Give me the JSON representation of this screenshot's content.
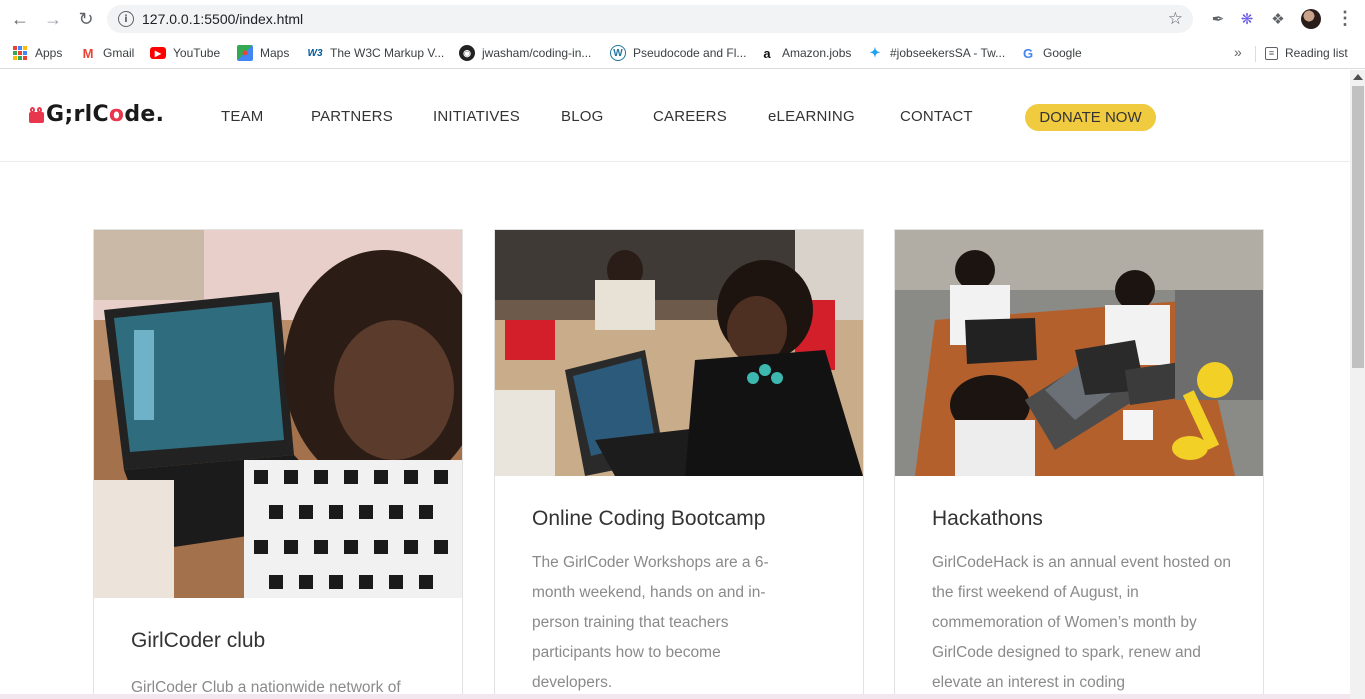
{
  "browser": {
    "url": "127.0.0.1:5500/index.html",
    "bookmarks": [
      {
        "label": "Apps",
        "icon": "apps-grid-icon"
      },
      {
        "label": "Gmail",
        "icon": "gmail-icon"
      },
      {
        "label": "YouTube",
        "icon": "youtube-icon"
      },
      {
        "label": "Maps",
        "icon": "maps-icon"
      },
      {
        "label": "The W3C Markup V...",
        "icon": "w3c-icon"
      },
      {
        "label": "jwasham/coding-in...",
        "icon": "github-icon"
      },
      {
        "label": "Pseudocode and Fl...",
        "icon": "wordpress-icon"
      },
      {
        "label": "Amazon.jobs",
        "icon": "amazon-icon"
      },
      {
        "label": "#jobseekersSA - Tw...",
        "icon": "twitter-icon"
      },
      {
        "label": "Google",
        "icon": "google-icon"
      }
    ],
    "bookmarks_more": "»",
    "reading_list": "Reading list"
  },
  "site": {
    "logo": {
      "part1": "G",
      "part2": ";rlC",
      "part3": "o",
      "part4": "de."
    },
    "nav": [
      "TEAM",
      "PARTNERS",
      "INITIATIVES",
      "BLOG",
      "CAREERS",
      "eLEARNING",
      "CONTACT"
    ],
    "donate": "DONATE NOW",
    "colors": {
      "accent": "#f0ca3f",
      "brand": "#e8364c"
    }
  },
  "cards": [
    {
      "title": "GirlCoder club",
      "body": "GirlCoder Club a nationwide network of"
    },
    {
      "title": "Online Coding Bootcamp",
      "body": "The GirlCoder Workshops are a 6-month weekend, hands on and in-person training that teachers participants how to become developers."
    },
    {
      "title": "Hackathons",
      "body": "GirlCodeHack is an annual event hosted on the first weekend of August, in commemoration of Women’s month by GirlCode designed to spark, renew and elevate an interest in coding"
    }
  ]
}
